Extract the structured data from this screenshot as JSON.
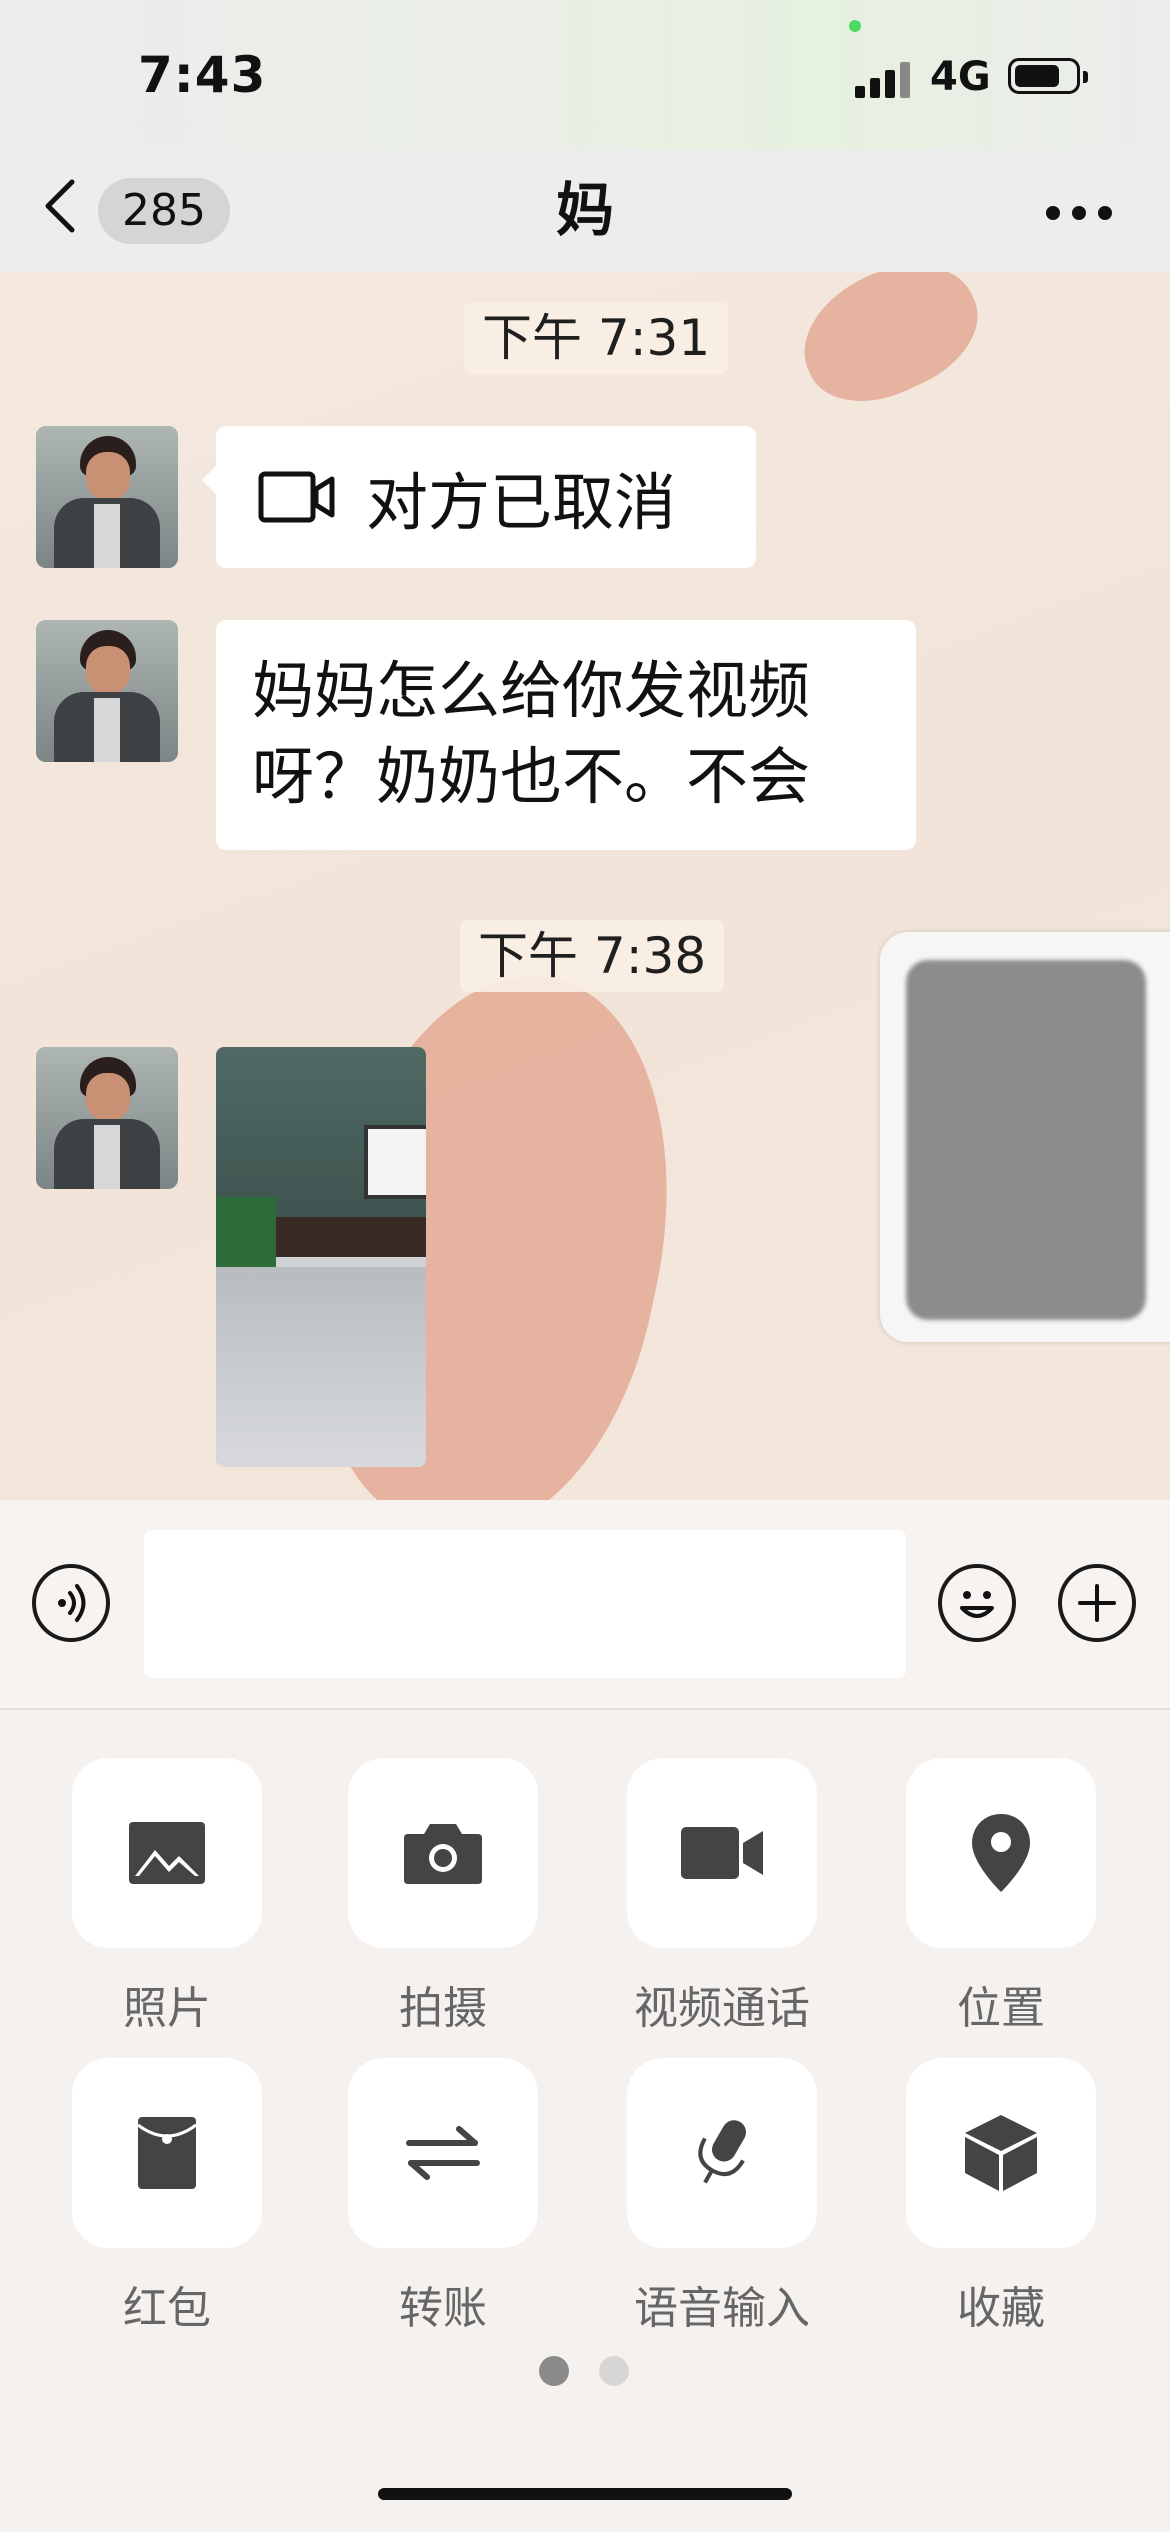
{
  "status_bar": {
    "time": "7:43",
    "network": "4G"
  },
  "header": {
    "unread_count": "285",
    "title": "妈"
  },
  "messages": [
    {
      "kind": "timestamp",
      "text": "下午 7:31"
    },
    {
      "kind": "video_call",
      "icon": "video-camera-icon",
      "text": "对方已取消"
    },
    {
      "kind": "text",
      "lines": [
        "妈妈怎么给你发视频",
        "呀？奶奶也不。不会"
      ]
    },
    {
      "kind": "timestamp",
      "text": "下午 7:38"
    },
    {
      "kind": "video",
      "thumbnail": "room-interior"
    }
  ],
  "input": {
    "value": ""
  },
  "panel": {
    "items": [
      {
        "label": "照片",
        "icon": "image-icon"
      },
      {
        "label": "拍摄",
        "icon": "camera-icon"
      },
      {
        "label": "视频通话",
        "icon": "video-call-icon"
      },
      {
        "label": "位置",
        "icon": "location-pin-icon"
      },
      {
        "label": "红包",
        "icon": "red-envelope-icon"
      },
      {
        "label": "转账",
        "icon": "transfer-icon"
      },
      {
        "label": "语音输入",
        "icon": "microphone-icon"
      },
      {
        "label": "收藏",
        "icon": "favorites-box-icon"
      }
    ],
    "page_count": 2,
    "current_page": 1
  },
  "colors": {
    "chat_bg": "#f3e6db",
    "heart": "#e1a690",
    "bubble": "#ffffff",
    "tile": "#ffffff"
  }
}
